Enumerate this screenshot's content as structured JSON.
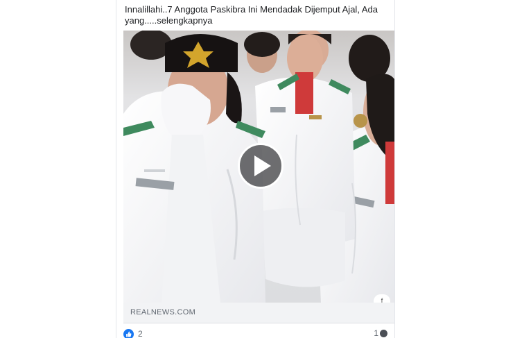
{
  "post": {
    "text_line1": "Innalillahi..7 Anggota Paskibra Ini Mendadak Dijemput Ajal, Ada",
    "text_line2": "yang.....selengkapnya"
  },
  "video": {
    "play_icon": "play-icon",
    "share_label": "f"
  },
  "link": {
    "domain": "REALNEWS.COM"
  },
  "reactions": {
    "icon": "like-icon",
    "count": "2"
  },
  "comments": {
    "count": "1",
    "icon": "comment-icon"
  },
  "colors": {
    "facebook_blue": "#1877f2",
    "link_bar_bg": "#f2f3f5",
    "uniform_white": "#f3f4f6",
    "collar_green": "#3f8a5e",
    "scarf_red": "#d23b3b"
  }
}
